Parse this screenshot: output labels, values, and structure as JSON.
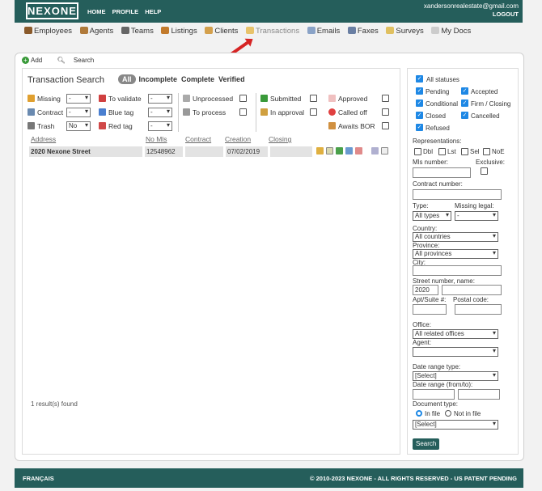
{
  "header": {
    "logo": "NEXONE",
    "nav": [
      "HOME",
      "PROFILE",
      "HELP"
    ],
    "user_email": "xandersonrealestate@gmail.com",
    "logout": "LOGOUT"
  },
  "modules": [
    {
      "label": "Employees",
      "icon": "people-icon",
      "color": "#8a5a2b"
    },
    {
      "label": "Agents",
      "icon": "agents-icon",
      "color": "#b07a3a"
    },
    {
      "label": "Teams",
      "icon": "teams-icon",
      "color": "#666666"
    },
    {
      "label": "Listings",
      "icon": "house-icon",
      "color": "#c27a2c"
    },
    {
      "label": "Clients",
      "icon": "client-icon",
      "color": "#d4a04c"
    },
    {
      "label": "Transactions",
      "icon": "folder-icon",
      "color": "#e8c36a"
    },
    {
      "label": "Emails",
      "icon": "envelope-icon",
      "color": "#8aa3c7"
    },
    {
      "label": "Faxes",
      "icon": "fax-icon",
      "color": "#6a7fa3"
    },
    {
      "label": "Surveys",
      "icon": "survey-icon",
      "color": "#e0c060"
    },
    {
      "label": "My Docs",
      "icon": "docs-icon",
      "color": "#cccccc"
    }
  ],
  "toolbar": {
    "add": "Add",
    "search": "Search"
  },
  "search": {
    "title": "Transaction Search",
    "tabs": [
      "All",
      "Incomplete",
      "Complete",
      "Verified"
    ]
  },
  "filters": {
    "missing": {
      "label": "Missing",
      "value": "-"
    },
    "to_validate": {
      "label": "To validate",
      "value": "-"
    },
    "contract": {
      "label": "Contract",
      "value": "-"
    },
    "blue_tag": {
      "label": "Blue tag",
      "value": "-"
    },
    "trash": {
      "label": "Trash",
      "value": "No"
    },
    "red_tag": {
      "label": "Red tag",
      "value": "-"
    },
    "unprocessed": "Unprocessed",
    "to_process": "To process",
    "submitted": "Submitted",
    "in_approval": "In approval",
    "approved": "Approved",
    "called_off": "Called off",
    "awaits_bor": "Awaits BOR"
  },
  "table": {
    "headers": [
      "Address",
      "No Mls",
      "Contract",
      "Creation",
      "Closing"
    ],
    "rows": [
      {
        "address": "2020 Nexone Street",
        "mls": "12548962",
        "contract": "",
        "creation": "07/02/2019",
        "closing": ""
      }
    ],
    "results": "1 result(s) found"
  },
  "sidebar": {
    "all_statuses": "All statuses",
    "statuses": {
      "pending": "Pending",
      "accepted": "Accepted",
      "conditional": "Conditional",
      "firm_closing": "Firm / Closing",
      "closed": "Closed",
      "cancelled": "Cancelled",
      "refused": "Refused"
    },
    "representations_label": "Representations:",
    "representations": [
      "Dbl",
      "Lst",
      "Sel",
      "NoE"
    ],
    "mls_label": "Mls number:",
    "exclusive_label": "Exclusive:",
    "contract_label": "Contract number:",
    "type_label": "Type:",
    "type_value": "All types",
    "missing_legal_label": "Missing legal:",
    "missing_legal_value": "-",
    "country_label": "Country:",
    "country_value": "All countries",
    "province_label": "Province:",
    "province_value": "All provinces",
    "city_label": "City:",
    "street_label": "Street number, name:",
    "street_number": "2020",
    "apt_label": "Apt/Suite #:",
    "postal_label": "Postal code:",
    "office_label": "Office:",
    "office_value": "All related offices",
    "agent_label": "Agent:",
    "agent_value": "",
    "date_type_label": "Date range type:",
    "date_type_value": "[Select]",
    "date_range_label": "Date range (from/to):",
    "doc_type_label": "Document type:",
    "in_file": "In file",
    "not_in_file": "Not in file",
    "doc_select_value": "[Select]",
    "search_button": "Search"
  },
  "footer": {
    "language": "FRANÇAIS",
    "copyright": "© 2010-2023 NEXONE - ALL RIGHTS RESERVED - US PATENT PENDING"
  }
}
